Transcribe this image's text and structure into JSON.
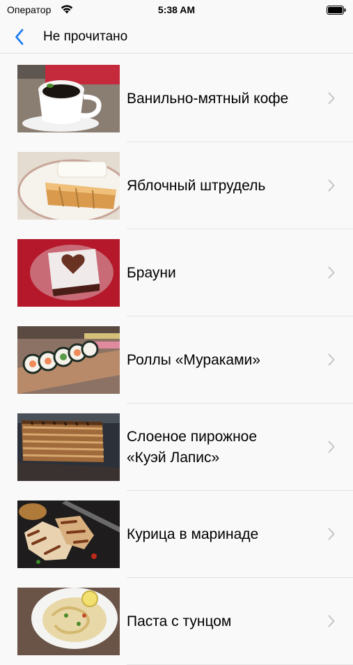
{
  "status": {
    "carrier": "Оператор",
    "time": "5:38 AM"
  },
  "nav": {
    "title": "Не прочитано",
    "back_icon": "chevron-left-icon",
    "accent": "#1a7cf5"
  },
  "items": [
    {
      "label": "Ванильно-мятный кофе",
      "image": "coffee-cup-image"
    },
    {
      "label": "Яблочный штрудель",
      "image": "apple-strudel-image"
    },
    {
      "label": "Брауни",
      "image": "brownie-image"
    },
    {
      "label": "Роллы «Мураками»",
      "image": "sushi-rolls-image"
    },
    {
      "label": "Слоеное пирожное\n«Куэй Лапис»",
      "image": "layered-cake-image"
    },
    {
      "label": "Курица в маринаде",
      "image": "marinated-chicken-image"
    },
    {
      "label": "Паста с тунцом",
      "image": "tuna-pasta-image"
    }
  ]
}
